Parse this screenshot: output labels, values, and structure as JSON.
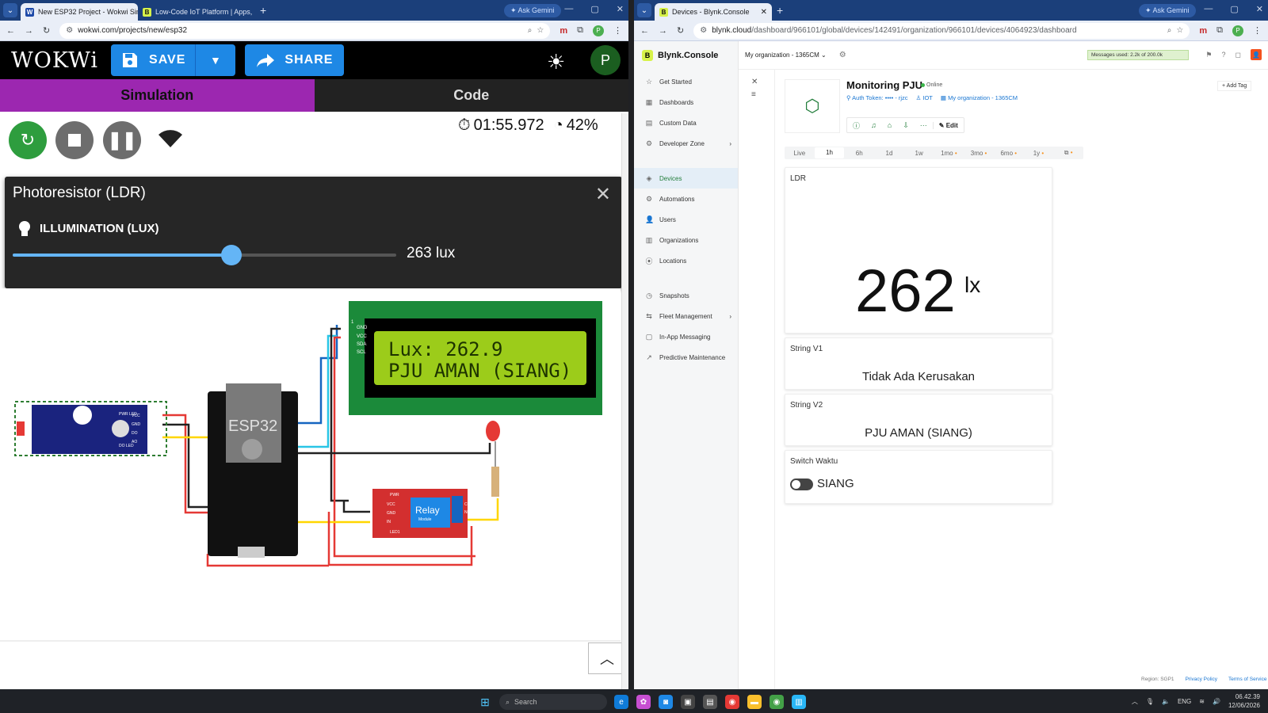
{
  "left_window": {
    "tabs": [
      {
        "title": "New ESP32 Project - Wokwi Sim",
        "favicon": "W"
      },
      {
        "title": "Low-Code IoT Platform | Apps,",
        "favicon": "B"
      }
    ],
    "gemini_label": "Ask Gemini",
    "url": "wokwi.com/projects/new/esp32"
  },
  "wokwi": {
    "logo": "WOKWi",
    "save_label": "SAVE",
    "share_label": "SHARE",
    "avatar_initial": "P",
    "tab_simulation": "Simulation",
    "tab_code": "Code",
    "timer": "01:55.972",
    "speed": "42%",
    "ldr_panel": {
      "title": "Photoresistor (LDR)",
      "label": "ILLUMINATION (LUX)",
      "value_text": "263 lux",
      "slider_fraction": 0.57
    },
    "lcd": {
      "line1": "Lux: 262.9",
      "line2": "PJU AMAN (SIANG)"
    },
    "esp32_label": "ESP32",
    "relay_label": "Relay",
    "relay_sub": "Module",
    "lcd_pins": [
      "GND",
      "VCC",
      "SDA",
      "SCL"
    ],
    "ldr_pins": [
      "VCC",
      "GND",
      "DO",
      "AO"
    ],
    "relay_pins": [
      "VCC",
      "GND",
      "IN"
    ],
    "relay_leds": [
      "PWR",
      "LED1"
    ],
    "ldr_leds": [
      "PWR LED",
      "DO LED"
    ],
    "relay_terms": [
      "COM",
      "NC"
    ],
    "lcd_pin1": "1",
    "colors": {
      "sim_tab": "#9c27b0",
      "code_tab": "#222222",
      "board": "#111111",
      "lcd_bg": "#9ccc1a",
      "lcd_frame": "#1b8a3a"
    }
  },
  "right_window": {
    "tab_title": "Devices - Blynk.Console",
    "gemini_label": "Ask Gemini",
    "url_host": "blynk.cloud",
    "url_path": "/dashboard/966101/global/devices/142491/organization/966101/devices/4064923/dashboard"
  },
  "blynk": {
    "brand": "Blynk.Console",
    "org_select": "My organization - 1365CM",
    "messages_used": "Messages used: 2.2k of 200.0k",
    "sidebar": [
      {
        "label": "Get Started",
        "icon": "☆"
      },
      {
        "label": "Dashboards",
        "icon": "▦"
      },
      {
        "label": "Custom Data",
        "icon": "▤"
      },
      {
        "label": "Developer Zone",
        "icon": "⚙",
        "arrow": true
      },
      {
        "label": "Devices",
        "icon": "◈",
        "active": true
      },
      {
        "label": "Automations",
        "icon": "⚙"
      },
      {
        "label": "Users",
        "icon": "👤"
      },
      {
        "label": "Organizations",
        "icon": "▥"
      },
      {
        "label": "Locations",
        "icon": "⦿"
      },
      {
        "label": "Snapshots",
        "icon": "◷"
      },
      {
        "label": "Fleet Management",
        "icon": "⇆",
        "arrow": true
      },
      {
        "label": "In-App Messaging",
        "icon": "▢"
      },
      {
        "label": "Predictive Maintenance",
        "icon": "↗"
      }
    ],
    "device": {
      "name": "Monitoring PJU",
      "status": "Online",
      "auth_token": "Auth Token: •••• - rjzc",
      "template": "IOT",
      "org": "My organization - 1365CM",
      "edit_label": "Edit",
      "add_tag": "Add Tag"
    },
    "time_ranges": [
      "Live",
      "1h",
      "6h",
      "1d",
      "1w",
      "1mo",
      "3mo",
      "6mo",
      "1y",
      "⧉"
    ],
    "selected_range": "1h",
    "widgets": {
      "ldr": {
        "title": "LDR",
        "value": "262",
        "unit": "lx"
      },
      "v1": {
        "title": "String V1",
        "value": "Tidak Ada Kerusakan"
      },
      "v2": {
        "title": "String V2",
        "value": "PJU AMAN (SIANG)"
      },
      "switch": {
        "title": "Switch Waktu",
        "state_label": "SIANG"
      }
    },
    "footer": {
      "region": "Region: SGP1",
      "privacy": "Privacy Policy",
      "terms": "Terms of Service"
    }
  },
  "taskbar": {
    "search_placeholder": "Search",
    "lang": "ENG",
    "time": "06.42.39",
    "date": "12/06/2026"
  }
}
